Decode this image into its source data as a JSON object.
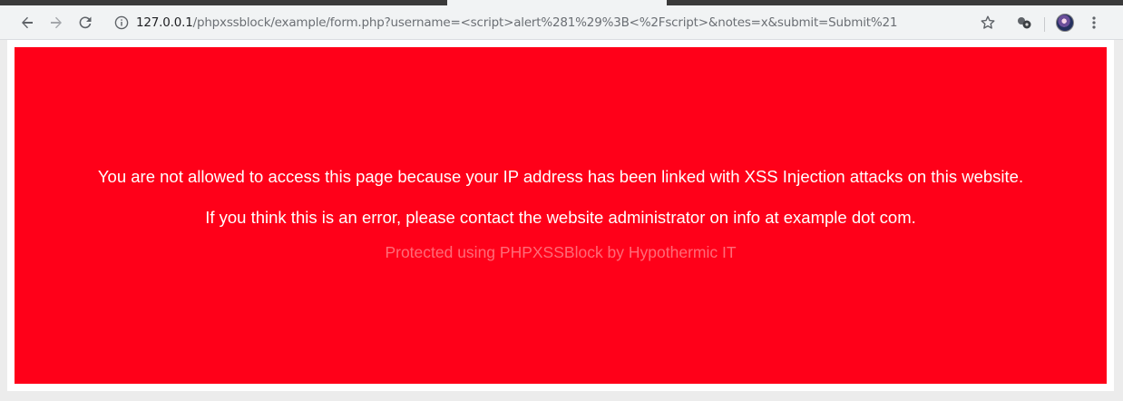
{
  "browser": {
    "address_bar": {
      "host": "127.0.0.1",
      "path": "/phpxssblock/example/form.php?username=<script>alert%281%29%3B<%2Fscript>&notes=x&submit=Submit%21"
    },
    "icons": {
      "back": "arrow-left-icon",
      "forward": "arrow-right-icon",
      "reload": "reload-icon",
      "site_info": "info-icon",
      "bookmark": "star-icon",
      "extension": "extension-icon",
      "profile": "avatar",
      "menu": "kebab-menu-icon"
    }
  },
  "page": {
    "background_color": "#ff0019",
    "message_line_1": "You are not allowed to access this page because your IP address has been linked with XSS Injection attacks on this website.",
    "message_line_2": "If you think this is an error, please contact the website administrator on info at example dot com.",
    "footer_text": "Protected using PHPXSSBlock by Hypothermic IT"
  }
}
